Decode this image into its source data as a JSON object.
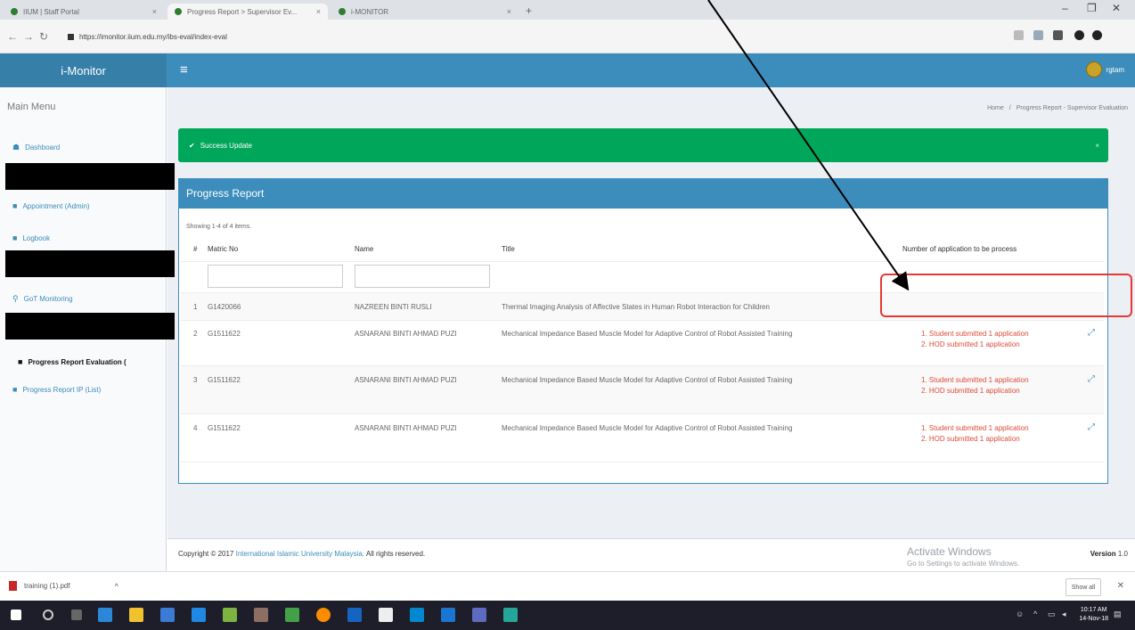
{
  "browser": {
    "tabs": [
      {
        "label": "IIUM | Staff Portal"
      },
      {
        "label": "Progress Report > Supervisor Ev..."
      },
      {
        "label": "i-MONITOR"
      }
    ],
    "url": "https://imonitor.iium.edu.my/ibs-eval/index-eval",
    "new_tab": "+",
    "min": "–",
    "restore": "❐",
    "close": "✕"
  },
  "app": {
    "logo": "i-Monitor",
    "menu_toggle": "≡",
    "user": "rgtam"
  },
  "sidebar": {
    "title": "Main Menu",
    "items": [
      {
        "icon": "☗",
        "label": "Dashboard"
      },
      {
        "icon": "■",
        "label": "Appointment (Admin)"
      },
      {
        "icon": "■",
        "label": "Logbook"
      },
      {
        "icon": "⚲",
        "label": "GoT Monitoring"
      },
      {
        "icon": "■",
        "label": "Progress Report Evaluation ("
      },
      {
        "icon": "■",
        "label": "Progress Report IP (List)"
      }
    ]
  },
  "breadcrumb": {
    "home": "Home",
    "sep": "/",
    "current": "Progress Report - Supervisor Evaluation"
  },
  "alert": {
    "icon": "✔",
    "text": "Success Update",
    "close": "×"
  },
  "panel": {
    "title": "Progress Report",
    "summary": "Showing 1-4 of 4 items.",
    "columns": [
      "#",
      "Matric No",
      "Name",
      "Title",
      "Number of application to be process"
    ],
    "rows": [
      {
        "num": "1",
        "matric": "G1420066",
        "name": "NAZREEN BINTI RUSLI",
        "title": "Thermal Imaging Analysis of Affective States in Human Robot Interaction for Children",
        "status1": "",
        "status2": ""
      },
      {
        "num": "2",
        "matric": "G1511622",
        "name": "ASNARANI BINTI AHMAD PUZI",
        "title": "Mechanical Impedance Based Muscle Model for Adaptive Control of Robot Assisted Training",
        "status1": "1. Student submitted 1 application",
        "status2": "2. HOD submitted 1 application"
      },
      {
        "num": "3",
        "matric": "G1511622",
        "name": "ASNARANI BINTI AHMAD PUZI",
        "title": "Mechanical Impedance Based Muscle Model for Adaptive Control of Robot Assisted Training",
        "status1": "1. Student submitted 1 application",
        "status2": "2. HOD submitted 1 application"
      },
      {
        "num": "4",
        "matric": "G1511622",
        "name": "ASNARANI BINTI AHMAD PUZI",
        "title": "Mechanical Impedance Based Muscle Model for Adaptive Control of Robot Assisted Training",
        "status1": "1. Student submitted 1 application",
        "status2": "2. HOD submitted 1 application"
      }
    ],
    "expand_icon": "⤢"
  },
  "footer": {
    "copyright": "Copyright © 2017",
    "org": "International Islamic University Malaysia.",
    "rights": "All rights reserved.",
    "version_label": "Version",
    "version": "1.0"
  },
  "watermark": {
    "line1": "Activate Windows",
    "line2": "Go to Settings to activate Windows."
  },
  "downloads": {
    "file": "training (1).pdf",
    "chevron": "^",
    "show_all": "Show all",
    "close": "✕"
  },
  "taskbar": {
    "time": "10:17 AM",
    "date": "14-Nov-18"
  },
  "colors": {
    "header": "#3c8dbc",
    "success": "#00a65a",
    "status": "#dd4b39",
    "annotation": "#e53935"
  }
}
